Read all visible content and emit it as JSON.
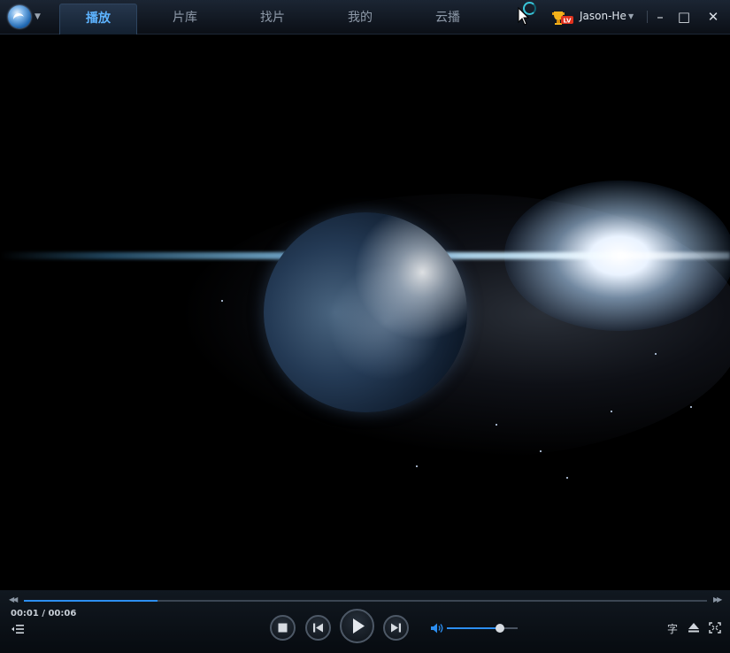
{
  "nav": {
    "tabs": [
      {
        "label": "播放",
        "active": true
      },
      {
        "label": "片库",
        "active": false
      },
      {
        "label": "找片",
        "active": false
      },
      {
        "label": "我的",
        "active": false
      },
      {
        "label": "云播",
        "active": false
      }
    ]
  },
  "user": {
    "name": "Jason-He",
    "badge_icon": "trophy-icon"
  },
  "window_controls": {
    "minimize": "–",
    "maximize": "□",
    "close": "✕"
  },
  "playback": {
    "time_text": "00:01 / 00:06",
    "progress": 0.195,
    "volume": 0.75,
    "subtitle_label": "字",
    "state": "paused"
  },
  "colors": {
    "accent": "#2c8ef0",
    "active_tab_text": "#5db3ff"
  }
}
